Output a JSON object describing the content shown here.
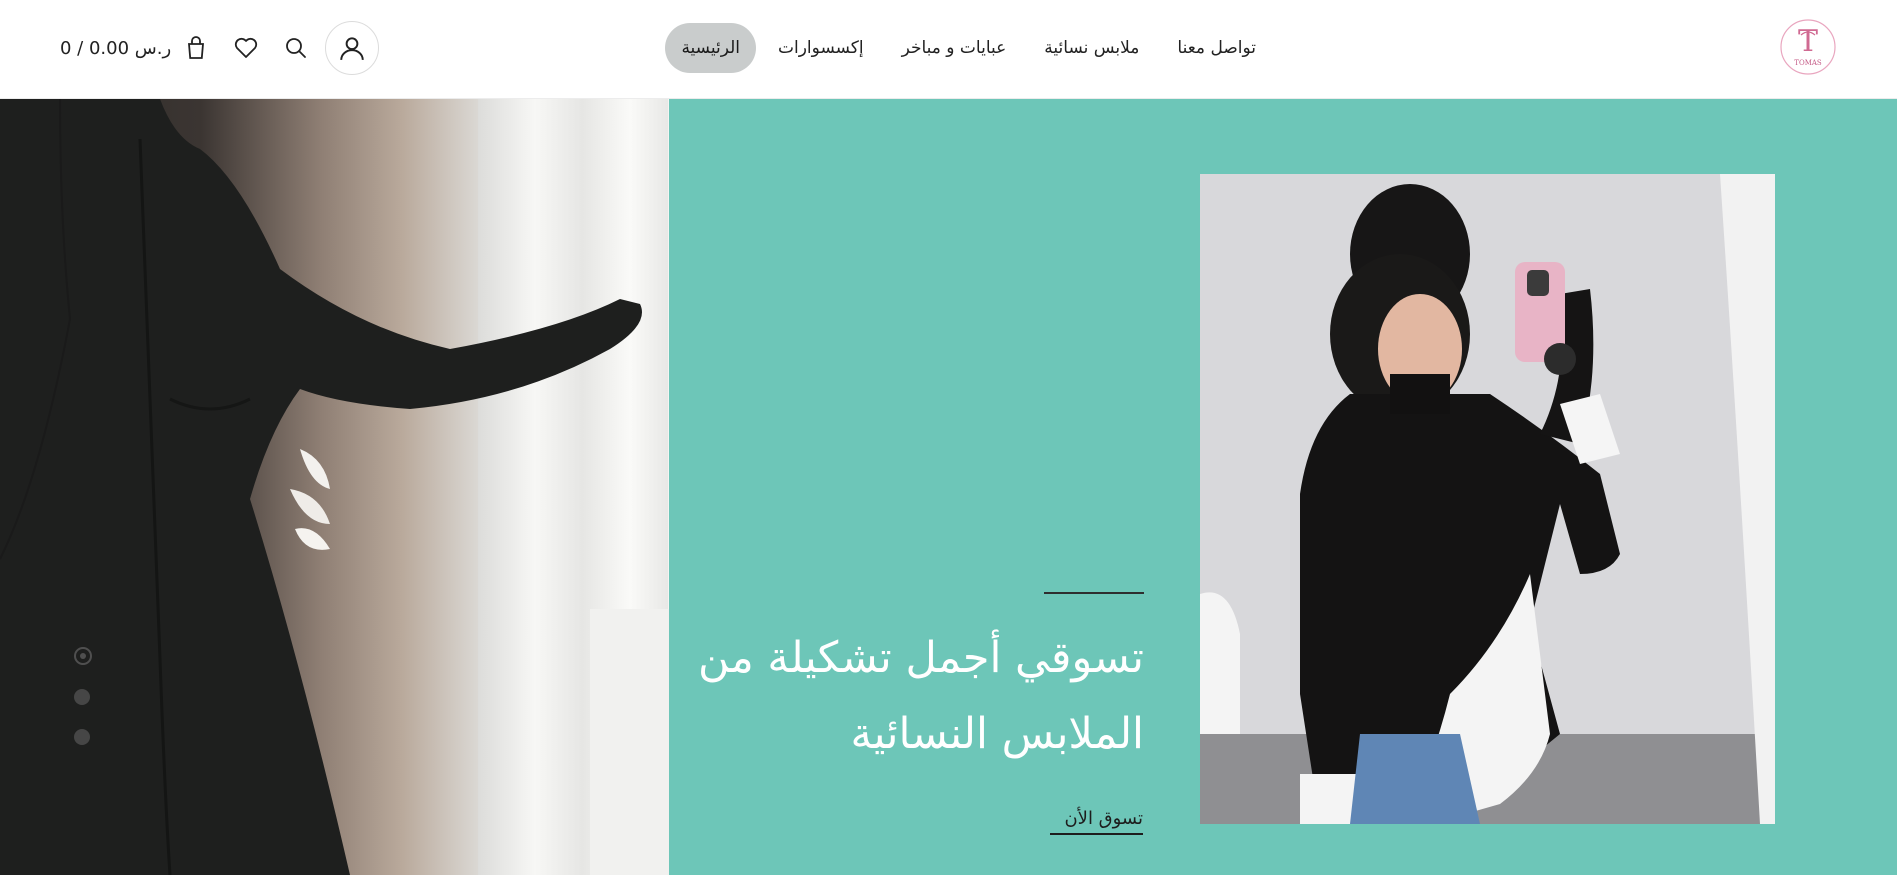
{
  "header": {
    "logo_text": "TOMAS",
    "nav": [
      {
        "label": "الرئيسية",
        "active": true
      },
      {
        "label": "إكسسوارات",
        "active": false
      },
      {
        "label": "عبايات و مباخر",
        "active": false
      },
      {
        "label": "ملابس نسائية",
        "active": false
      },
      {
        "label": "تواصل معنا",
        "active": false
      }
    ],
    "cart_summary": "ر.س 0.00 / 0",
    "icons": [
      "cart-icon",
      "heart-icon",
      "search-icon",
      "user-icon"
    ]
  },
  "hero": {
    "title": "تسوقي أجمل تشكيلة من الملابس النسائية",
    "cta": "تسوق الأن",
    "slide_count": 3,
    "active_slide": 1,
    "accent_color": "#6dc6b8"
  }
}
